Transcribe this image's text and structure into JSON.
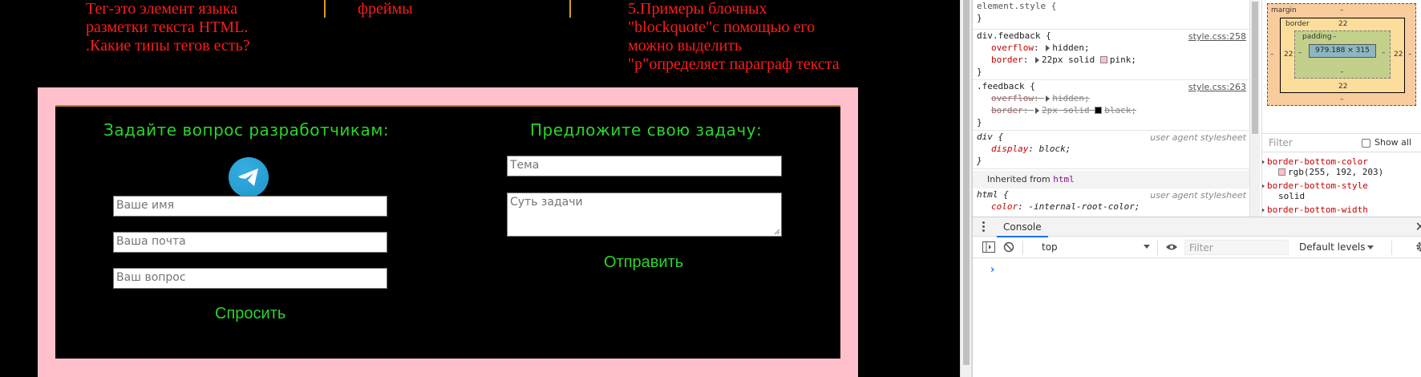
{
  "page": {
    "columns": [
      [
        "Тег-это элемент языка",
        "разметки текста HTML.",
        ".Какие типы тегов есть?"
      ],
      [
        "фреймы"
      ],
      [
        "5.Примеры блочных",
        "\"blockquote\"с помощью его",
        "можно выделить",
        "\"p\"определяет параграф текста"
      ]
    ],
    "feedback": {
      "left": {
        "title": "Задайте вопрос разработчикам:",
        "name_placeholder": "Ваше имя",
        "email_placeholder": "Ваша почта",
        "question_placeholder": "Ваш вопрос",
        "button": "Спросить"
      },
      "right": {
        "title": "Предложите свою задачу:",
        "topic_placeholder": "Тема",
        "task_placeholder": "Суть задачи",
        "button": "Отправить"
      }
    },
    "colors": {
      "text_red": "#ff1a1a",
      "title_green": "#2bd42b",
      "feedback_border": "#ffc0cb"
    }
  },
  "devtools": {
    "rules": {
      "element_style": "element.style {",
      "close": "}",
      "r1_selector": "div.feedback {",
      "r1_source": "style.css:258",
      "r1_p1_name": "overflow",
      "r1_p1_value": "hidden;",
      "r1_p2_name": "border",
      "r1_p2_value": "22px solid",
      "r1_p2_color": "pink;",
      "r2_selector": ".feedback {",
      "r2_source": "style.css:263",
      "r2_p1_name": "overflow",
      "r2_p1_value": "hidden;",
      "r2_p2_name": "border",
      "r2_p2_value": "2px solid",
      "r2_p2_color": "black;",
      "r3_selector": "div {",
      "r3_source": "user agent stylesheet",
      "r3_p1_name": "display",
      "r3_p1_value": "block;",
      "inherited_label": "Inherited from",
      "inherited_tag": "html",
      "r4_selector": "html {",
      "r4_source": "user agent stylesheet",
      "r4_p1_name": "color",
      "r4_p1_value": "-internal-root-color;"
    },
    "boxmodel": {
      "margin_label": "margin",
      "margin_value": "–",
      "border_label": "border",
      "border_value": "22",
      "padding_label": "padding",
      "padding_value": "–",
      "content": "979.188 × 315",
      "side_margin": "–",
      "side_border": "22",
      "side_padding": "–"
    },
    "computed": {
      "filter_placeholder": "Filter",
      "show_all": "Show all",
      "props": [
        {
          "name": "border-bottom-color",
          "value": "rgb(255, 192, 203)"
        },
        {
          "name": "border-bottom-style",
          "value": "solid"
        },
        {
          "name": "border-bottom-width",
          "value": ""
        }
      ]
    },
    "drawer": {
      "tab": "Console",
      "context": "top",
      "filter_placeholder": "Filter",
      "levels": "Default levels",
      "prompt": "›"
    }
  }
}
